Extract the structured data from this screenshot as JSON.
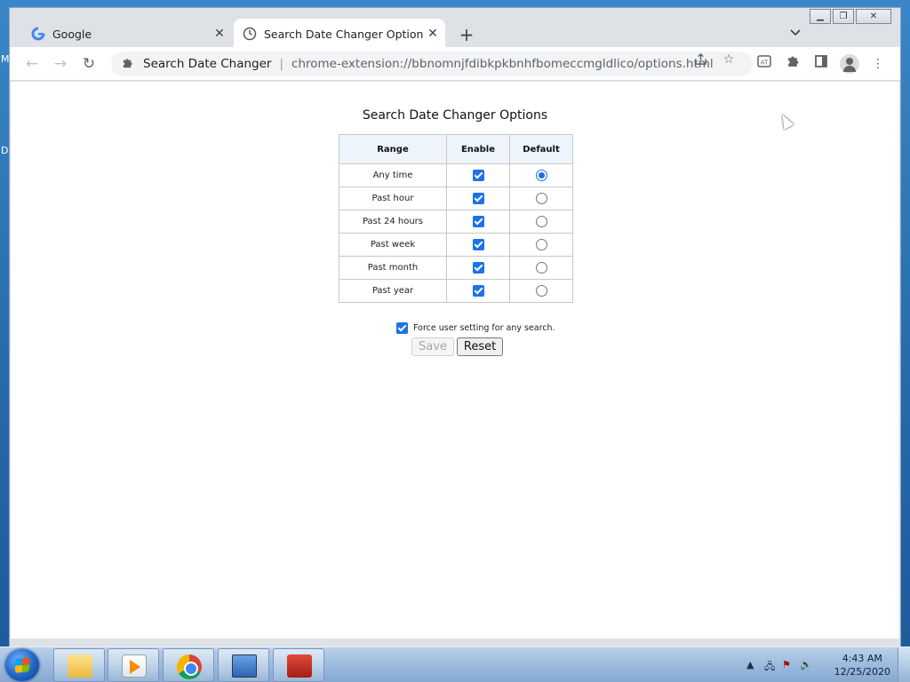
{
  "desktop": {
    "left_letters": [
      "M",
      "D"
    ]
  },
  "window": {
    "tabs": [
      {
        "title": "Google",
        "icon": "google-g-icon"
      },
      {
        "title": "Search Date Changer Options",
        "icon": "clock-icon"
      }
    ],
    "new_tab_glyph": "+",
    "tab_search_glyph": "⌄"
  },
  "toolbar": {
    "extension_name": "Search Date Changer",
    "url": "chrome-extension://bbnomnjfdibkpkbnhfbomeccmgldlico/options.html"
  },
  "page": {
    "title": "Search Date Changer Options",
    "table": {
      "headers": [
        "Range",
        "Enable",
        "Default"
      ],
      "rows": [
        {
          "range": "Any time",
          "enabled": true,
          "default": true
        },
        {
          "range": "Past hour",
          "enabled": true,
          "default": false
        },
        {
          "range": "Past 24 hours",
          "enabled": true,
          "default": false
        },
        {
          "range": "Past week",
          "enabled": true,
          "default": false
        },
        {
          "range": "Past month",
          "enabled": true,
          "default": false
        },
        {
          "range": "Past year",
          "enabled": true,
          "default": false
        }
      ]
    },
    "force_label": "Force user setting for any search.",
    "force_checked": true,
    "save_label": "Save",
    "reset_label": "Reset"
  },
  "taskbar": {
    "time": "4:43 AM",
    "date": "12/25/2020"
  },
  "colors": {
    "accent": "#1a73e8",
    "tab_active_bg": "#ffffff",
    "tabstrip_bg": "#dee1e6",
    "header_bg": "#eef4fb"
  }
}
